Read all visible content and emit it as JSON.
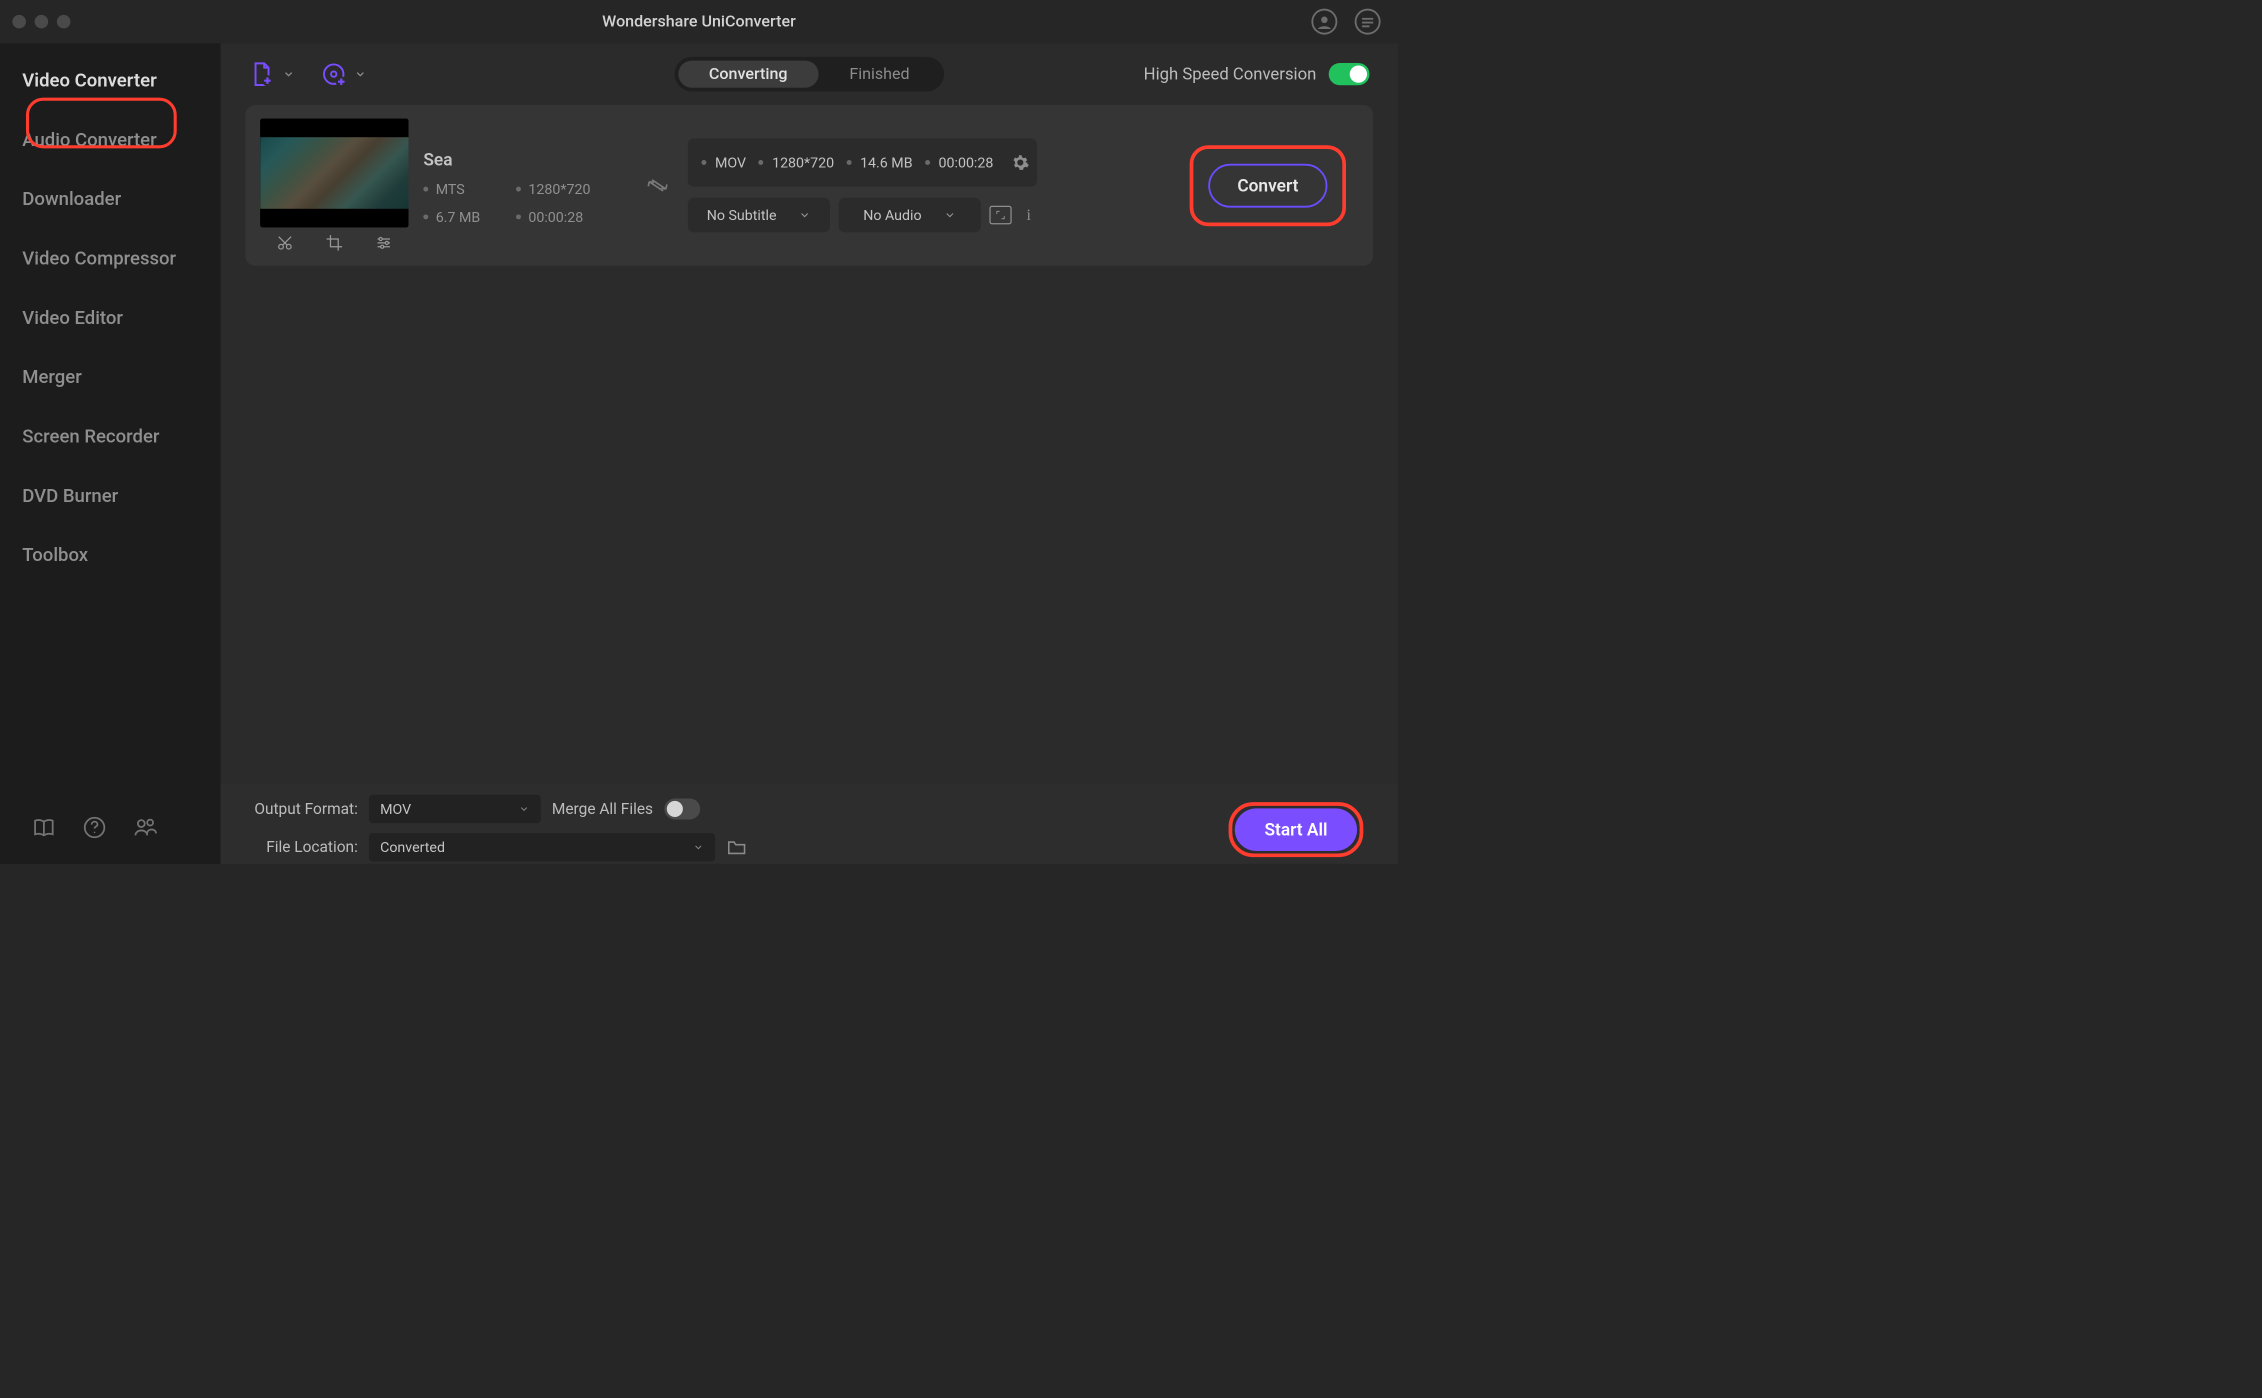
{
  "app_title": "Wondershare UniConverter",
  "sidebar": {
    "items": [
      "Video Converter",
      "Audio Converter",
      "Downloader",
      "Video Compressor",
      "Video Editor",
      "Merger",
      "Screen Recorder",
      "DVD Burner",
      "Toolbox"
    ]
  },
  "tabs": {
    "converting": "Converting",
    "finished": "Finished"
  },
  "toolbar": {
    "high_speed_label": "High Speed Conversion"
  },
  "file": {
    "name": "Sea",
    "src_format": "MTS",
    "src_resolution": "1280*720",
    "src_size": "6.7 MB",
    "src_duration": "00:00:28",
    "out_format": "MOV",
    "out_resolution": "1280*720",
    "out_size": "14.6 MB",
    "out_duration": "00:00:28",
    "subtitle": "No Subtitle",
    "audio": "No Audio",
    "convert_label": "Convert"
  },
  "bottom": {
    "output_format_label": "Output Format:",
    "output_format_value": "MOV",
    "merge_label": "Merge All Files",
    "file_location_label": "File Location:",
    "file_location_value": "Converted",
    "start_all_label": "Start All"
  }
}
